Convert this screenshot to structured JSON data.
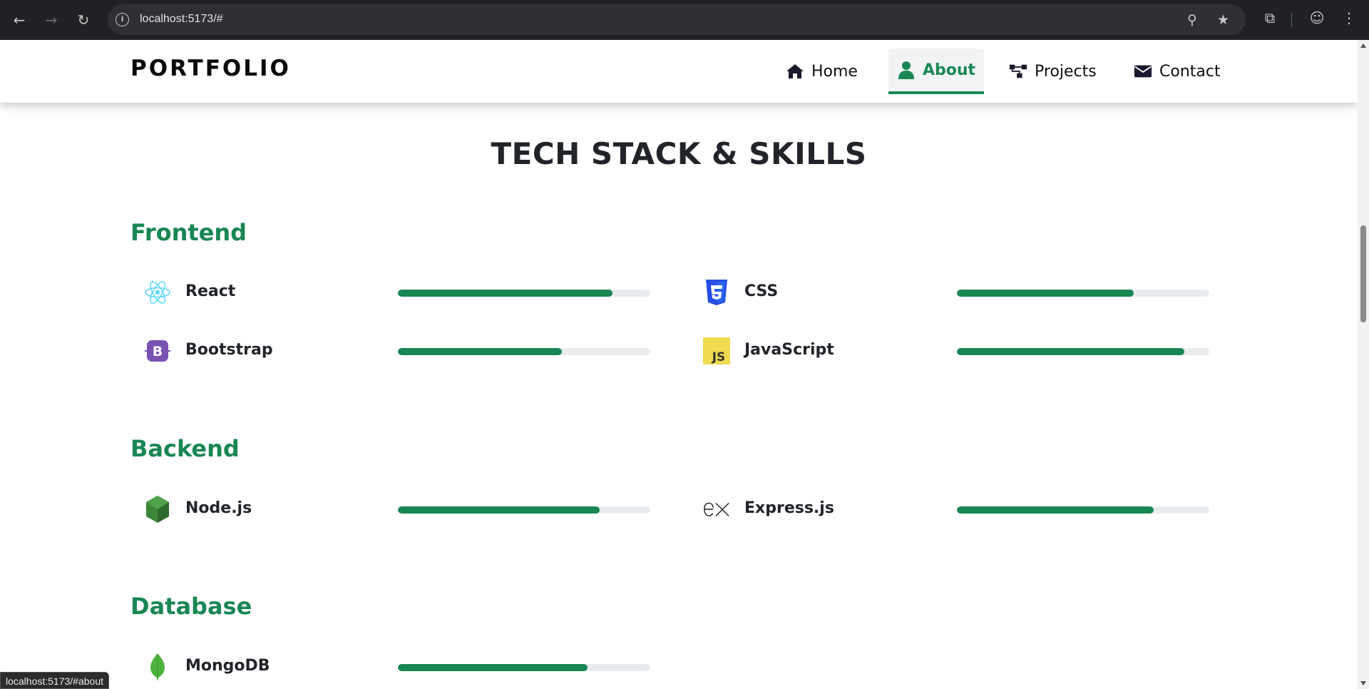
{
  "browser": {
    "url": "localhost:5173/#",
    "status_url": "localhost:5173/#about"
  },
  "navbar": {
    "brand": "PORTFOLIO",
    "items": [
      {
        "label": "Home",
        "icon": "home-icon",
        "active": false
      },
      {
        "label": "About",
        "icon": "user-icon",
        "active": true
      },
      {
        "label": "Projects",
        "icon": "sitemap-icon",
        "active": false
      },
      {
        "label": "Contact",
        "icon": "envelope-icon",
        "active": false
      }
    ]
  },
  "section": {
    "title": "TECH STACK & SKILLS"
  },
  "groups": [
    {
      "title": "Frontend",
      "skills": [
        {
          "name": "React",
          "icon": "react-icon",
          "level": 0.85
        },
        {
          "name": "CSS",
          "icon": "css3-icon",
          "level": 0.7
        },
        {
          "name": "Bootstrap",
          "icon": "bootstrap-icon",
          "level": 0.65
        },
        {
          "name": "JavaScript",
          "icon": "javascript-icon",
          "level": 0.9
        }
      ]
    },
    {
      "title": "Backend",
      "skills": [
        {
          "name": "Node.js",
          "icon": "nodejs-icon",
          "level": 0.8
        },
        {
          "name": "Express.js",
          "icon": "express-icon",
          "level": 0.78
        }
      ]
    },
    {
      "title": "Database",
      "skills": [
        {
          "name": "MongoDB",
          "icon": "mongodb-icon",
          "level": 0.75
        }
      ]
    }
  ],
  "colors": {
    "accent": "#198754",
    "track": "#e9ecef",
    "react": "#61dafb",
    "css": "#264de4",
    "bootstrap": "#7952b3",
    "javascript": "#f0db4f",
    "nodejs": "#3c873a",
    "mongodb": "#4db33d"
  }
}
